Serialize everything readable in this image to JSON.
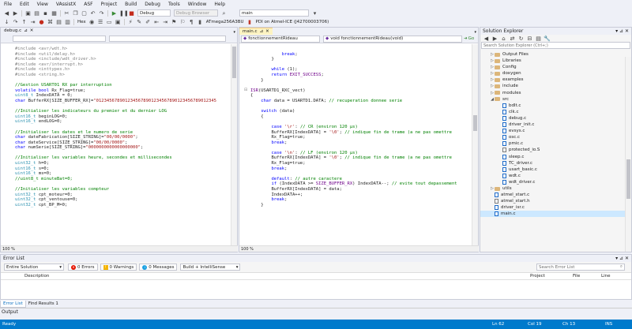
{
  "menu": [
    "File",
    "Edit",
    "View",
    "VAssistX",
    "ASF",
    "Project",
    "Build",
    "Debug",
    "Tools",
    "Window",
    "Help"
  ],
  "toolbar": {
    "config": "Debug",
    "debug_browser": "Debug Browser",
    "search_combo": "main",
    "hex_label": "Hex",
    "device": "ATmega256A3BU",
    "tool": "PDI on Atmel-ICE (J42700003706)"
  },
  "left_doc": {
    "tab": "debug.c",
    "zoom": "100 %",
    "lines": [
      [
        [
          "pp",
          "#include <avr/wdt.h>"
        ]
      ],
      [
        [
          "pp",
          "#include <util/delay.h>"
        ]
      ],
      [
        [
          "pp",
          "#include <include/wdt_driver.h>"
        ]
      ],
      [
        [
          "pp",
          "#include <avr/interrupt.h>"
        ]
      ],
      [
        [
          "pp",
          "#include <inttypes.h>"
        ]
      ],
      [
        [
          "pp",
          "#include <string.h>"
        ]
      ],
      [],
      [
        [
          "cm",
          "//Gestion USART01 RX par interruption"
        ]
      ],
      [
        [
          "kw",
          "volatile "
        ],
        [
          "kw",
          "bool "
        ],
        [
          "tx",
          "Rx_Flag=true;"
        ]
      ],
      [
        [
          "ty",
          "uint8_t "
        ],
        [
          "tx",
          "IndexDATA = 0;"
        ]
      ],
      [
        [
          "kw",
          "char "
        ],
        [
          "tx",
          "BufferRX[SIZE_BUFFER_RX]="
        ],
        [
          "st",
          "\"0123456789012345678901234567890123456789012345"
        ]
      ],
      [],
      [
        [
          "cm",
          "//Initialiser les indicateurs du premier et du dernier LOG"
        ]
      ],
      [
        [
          "ty",
          "uint16_t "
        ],
        [
          "tx",
          "beginLOG=0;"
        ]
      ],
      [
        [
          "ty",
          "uint16_t "
        ],
        [
          "tx",
          "endLOG=0;"
        ]
      ],
      [],
      [
        [
          "cm",
          "//Initialiser les dates et le numero de serie"
        ]
      ],
      [
        [
          "kw",
          "char "
        ],
        [
          "tx",
          "dateFabrication[SIZE_STRING]="
        ],
        [
          "st",
          "\"00/00/0000\""
        ],
        [
          "tx",
          ";"
        ]
      ],
      [
        [
          "kw",
          "char "
        ],
        [
          "tx",
          "dateService[SIZE_STRING]="
        ],
        [
          "st",
          "\"00/00/0000\""
        ],
        [
          "tx",
          ";"
        ]
      ],
      [
        [
          "kw",
          "char "
        ],
        [
          "tx",
          "numSerie[SIZE_STRING]="
        ],
        [
          "st",
          "\"0000000000000000000\""
        ],
        [
          "tx",
          ";"
        ]
      ],
      [],
      [
        [
          "cm",
          "//Initialiser les variables heure, secondes et millisecondes"
        ]
      ],
      [
        [
          "ty",
          "uint32_t "
        ],
        [
          "tx",
          "h=0;"
        ]
      ],
      [
        [
          "ty",
          "uint16_t "
        ],
        [
          "tx",
          "s=0;"
        ]
      ],
      [
        [
          "ty",
          "uint16_t "
        ],
        [
          "tx",
          "ms=0;"
        ]
      ],
      [
        [
          "cm",
          "//uint8_t minuteBat=0;"
        ]
      ],
      [],
      [
        [
          "cm",
          "//Initialiser les variables compteur"
        ]
      ],
      [
        [
          "ty",
          "uint32_t "
        ],
        [
          "tx",
          "cpt_moteur=0;"
        ]
      ],
      [
        [
          "ty",
          "uint32_t "
        ],
        [
          "tx",
          "cpt_ventouse=0;"
        ]
      ],
      [
        [
          "ty",
          "uint32_t "
        ],
        [
          "tx",
          "cpt_BP_M=0;"
        ]
      ]
    ]
  },
  "mid_doc": {
    "tab": "main.c",
    "nav_left": "fonctionnementRideau",
    "nav_right": "void fonctionnementRideau(void)",
    "go_label": "Go",
    "zoom": "100 %",
    "lines": [
      [],
      [
        [
          "tx",
          "            "
        ],
        [
          "kw",
          "break"
        ],
        [
          "tx",
          ";"
        ]
      ],
      [
        [
          "tx",
          "        }"
        ]
      ],
      [],
      [
        [
          "tx",
          "        "
        ],
        [
          "kw",
          "while "
        ],
        [
          "tx",
          "(1);"
        ]
      ],
      [
        [
          "tx",
          "        "
        ],
        [
          "kw",
          "return "
        ],
        [
          "mac",
          "EXIT_SUCCESS"
        ],
        [
          "tx",
          ";"
        ]
      ],
      [
        [
          "tx",
          "    }"
        ]
      ],
      [],
      [
        [
          "mac",
          "ISR"
        ],
        [
          "tx",
          "(USARTD1_RXC_vect)"
        ]
      ],
      [
        [
          "tx",
          "{"
        ]
      ],
      [
        [
          "tx",
          "    "
        ],
        [
          "kw",
          "char "
        ],
        [
          "tx",
          "data = USARTD1.DATA; "
        ],
        [
          "cm",
          "// recuperation donnee serie"
        ]
      ],
      [],
      [
        [
          "tx",
          "    "
        ],
        [
          "kw",
          "switch "
        ],
        [
          "tx",
          "(data)"
        ]
      ],
      [
        [
          "tx",
          "    {"
        ]
      ],
      [],
      [
        [
          "tx",
          "        "
        ],
        [
          "kw",
          "case "
        ],
        [
          "st",
          "'\\r'"
        ],
        [
          "tx",
          ": "
        ],
        [
          "cm",
          "// CR (environ 120 µs)"
        ]
      ],
      [
        [
          "tx",
          "        BufferRX[IndexDATA] = "
        ],
        [
          "st",
          "'\\0'"
        ],
        [
          "tx",
          "; "
        ],
        [
          "cm",
          "// indique fin de trame (a ne pas omettre"
        ]
      ],
      [
        [
          "tx",
          "        Rx_Flag=true;"
        ]
      ],
      [
        [
          "tx",
          "        "
        ],
        [
          "kw",
          "break"
        ],
        [
          "tx",
          ";"
        ]
      ],
      [],
      [
        [
          "tx",
          "        "
        ],
        [
          "kw",
          "case "
        ],
        [
          "st",
          "'\\n'"
        ],
        [
          "tx",
          ": "
        ],
        [
          "cm",
          "// LF (environ 120 µs)"
        ]
      ],
      [
        [
          "tx",
          "        BufferRX[IndexDATA] = "
        ],
        [
          "st",
          "'\\0'"
        ],
        [
          "tx",
          "; "
        ],
        [
          "cm",
          "// indique fin de trame (a ne pas omettre"
        ]
      ],
      [
        [
          "tx",
          "        Rx_Flag=true;"
        ]
      ],
      [
        [
          "tx",
          "        "
        ],
        [
          "kw",
          "break"
        ],
        [
          "tx",
          ";"
        ]
      ],
      [],
      [
        [
          "tx",
          "        "
        ],
        [
          "kw",
          "default"
        ],
        [
          "tx",
          ": "
        ],
        [
          "cm",
          "// autre caractere"
        ]
      ],
      [
        [
          "tx",
          "        "
        ],
        [
          "kw",
          "if "
        ],
        [
          "tx",
          "(IndexDATA >= "
        ],
        [
          "mac",
          "SIZE_BUFFER_RX"
        ],
        [
          "tx",
          ") IndexDATA--; "
        ],
        [
          "cm",
          "// evite tout depassement"
        ]
      ],
      [
        [
          "tx",
          "        BufferRX[IndexDATA] = data;"
        ]
      ],
      [
        [
          "tx",
          "        IndexDATA++;"
        ]
      ],
      [
        [
          "tx",
          "        "
        ],
        [
          "kw",
          "break"
        ],
        [
          "tx",
          ";"
        ]
      ],
      [
        [
          "tx",
          "    }"
        ]
      ]
    ]
  },
  "solution_explorer": {
    "title": "Solution Explorer",
    "search_placeholder": "Search Solution Explorer (Ctrl+;)",
    "items": [
      {
        "label": "Output Files",
        "kind": "folder",
        "depth": 1,
        "arrow": "▷"
      },
      {
        "label": "Libraries",
        "kind": "folder",
        "depth": 1,
        "arrow": "▷"
      },
      {
        "label": "Config",
        "kind": "folder",
        "depth": 1,
        "arrow": "▷"
      },
      {
        "label": "doxygen",
        "kind": "folder",
        "depth": 1,
        "arrow": "▷"
      },
      {
        "label": "examples",
        "kind": "folder",
        "depth": 1,
        "arrow": "▷"
      },
      {
        "label": "include",
        "kind": "folder",
        "depth": 1,
        "arrow": "▷"
      },
      {
        "label": "modules",
        "kind": "folder",
        "depth": 1,
        "arrow": "▷"
      },
      {
        "label": "src",
        "kind": "folder",
        "depth": 1,
        "arrow": "◢"
      },
      {
        "label": "bdlt.c",
        "kind": "c",
        "depth": 2,
        "arrow": ""
      },
      {
        "label": "clk.c",
        "kind": "c",
        "depth": 2,
        "arrow": ""
      },
      {
        "label": "debug.c",
        "kind": "c",
        "depth": 2,
        "arrow": ""
      },
      {
        "label": "driver_init.c",
        "kind": "c",
        "depth": 2,
        "arrow": ""
      },
      {
        "label": "evsys.c",
        "kind": "c",
        "depth": 2,
        "arrow": ""
      },
      {
        "label": "osc.c",
        "kind": "c",
        "depth": 2,
        "arrow": ""
      },
      {
        "label": "pmic.c",
        "kind": "c",
        "depth": 2,
        "arrow": ""
      },
      {
        "label": "protected_io.S",
        "kind": "s",
        "depth": 2,
        "arrow": ""
      },
      {
        "label": "sleep.c",
        "kind": "c",
        "depth": 2,
        "arrow": ""
      },
      {
        "label": "TC_driver.c",
        "kind": "c",
        "depth": 2,
        "arrow": ""
      },
      {
        "label": "usart_basic.c",
        "kind": "c",
        "depth": 2,
        "arrow": ""
      },
      {
        "label": "wdt.c",
        "kind": "c",
        "depth": 2,
        "arrow": ""
      },
      {
        "label": "wdt_driver.c",
        "kind": "c",
        "depth": 2,
        "arrow": ""
      },
      {
        "label": "utils",
        "kind": "folder",
        "depth": 1,
        "arrow": "▷"
      },
      {
        "label": "atmel_start.c",
        "kind": "c",
        "depth": 1,
        "arrow": ""
      },
      {
        "label": "atmel_start.h",
        "kind": "h",
        "depth": 1,
        "arrow": ""
      },
      {
        "label": "driver_isr.c",
        "kind": "c",
        "depth": 1,
        "arrow": ""
      },
      {
        "label": "main.c",
        "kind": "c",
        "depth": 1,
        "arrow": "",
        "selected": true
      }
    ]
  },
  "error_list": {
    "title": "Error List",
    "scope": "Entire Solution",
    "errors": "0 Errors",
    "warnings": "0 Warnings",
    "messages": "0 Messages",
    "build_filter": "Build + IntelliSense",
    "search_placeholder": "Search Error List",
    "col_description": "Description",
    "col_project": "Project",
    "col_file": "File",
    "col_line": "Line"
  },
  "bottom_tabs": [
    "Error List",
    "Find Results 1"
  ],
  "output_label": "Output",
  "status": {
    "left": "Ready",
    "ln": "Ln 62",
    "col": "Col 19",
    "ch": "Ch 13",
    "ins": "INS"
  },
  "colors": {
    "statusbar": "#007acc",
    "active_tab": "#fcf3c2"
  }
}
